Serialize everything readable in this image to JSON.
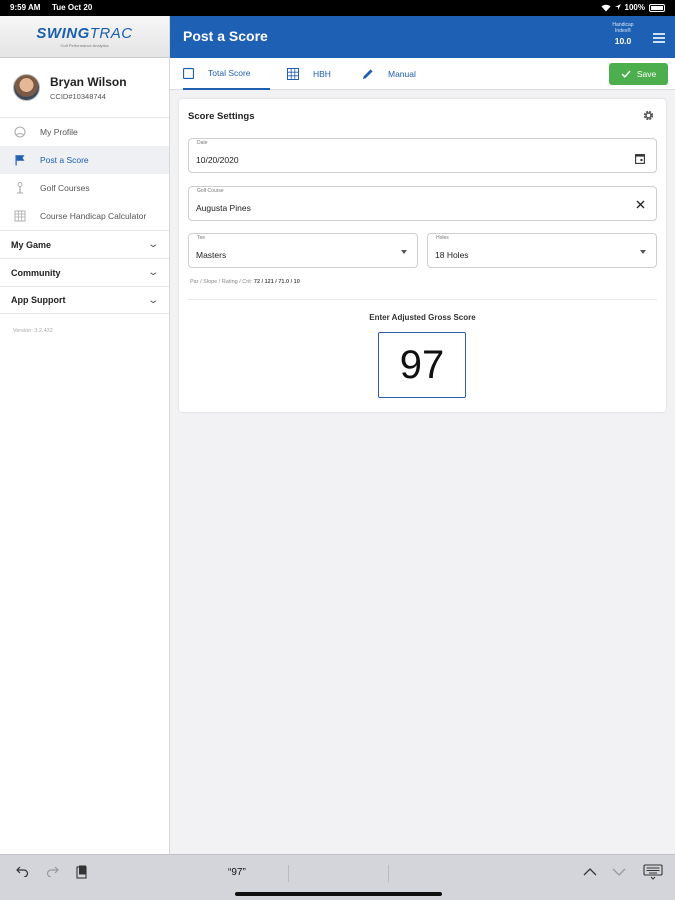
{
  "status_bar": {
    "time": "9:59 AM",
    "date": "Tue Oct 20",
    "battery": "100%"
  },
  "sidebar": {
    "logo": {
      "part1": "SWING",
      "part2": "TRAC",
      "tagline": "Golf Performance Analytics"
    },
    "user": {
      "name": "Bryan Wilson",
      "id": "CCID#10348744"
    },
    "items": [
      {
        "label": "My Profile",
        "icon": "profile-circle-icon"
      },
      {
        "label": "Post a Score",
        "icon": "flag-icon"
      },
      {
        "label": "Golf Courses",
        "icon": "golf-tee-icon"
      },
      {
        "label": "Course Handicap Calculator",
        "icon": "calculator-icon"
      }
    ],
    "sections": [
      {
        "label": "My Game"
      },
      {
        "label": "Community"
      },
      {
        "label": "App Support"
      }
    ],
    "version": "Version: 3.2.432"
  },
  "header": {
    "title": "Post a Score",
    "handicap_label_1": "Handicap",
    "handicap_label_2": "Index®",
    "handicap_value": "10.0"
  },
  "tabs": [
    {
      "label": "Total Score",
      "icon": "checkbox-icon",
      "active": true
    },
    {
      "label": "HBH",
      "icon": "grid-icon",
      "active": false
    },
    {
      "label": "Manual",
      "icon": "pencil-icon",
      "active": false
    }
  ],
  "save_label": "Save",
  "score_settings": {
    "title": "Score Settings",
    "date": {
      "label": "Date",
      "value": "10/20/2020"
    },
    "golf_course": {
      "label": "Golf Course",
      "value": "Augusta Pines"
    },
    "tee": {
      "label": "Tee",
      "value": "Masters"
    },
    "holes": {
      "label": "Holes",
      "value": "18 Holes"
    },
    "par_label": "Par / Slope / Rating / Crit:",
    "par_values": "72 / 121 / 71.0 / 10"
  },
  "score_entry": {
    "label": "Enter Adjusted Gross Score",
    "value": "97"
  },
  "keyboard_bar": {
    "suggestion": "“97”"
  },
  "colors": {
    "header_blue": "#1e60b4",
    "save_green": "#4cae4c",
    "accent": "#1e5faf"
  }
}
